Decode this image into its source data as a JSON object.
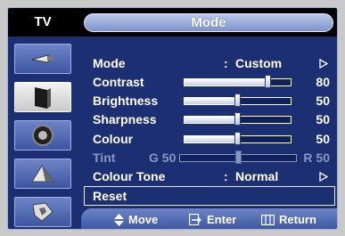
{
  "header": {
    "source_label": "TV",
    "title": "Mode"
  },
  "sidebar": {
    "items": [
      {
        "icon": "antenna-icon",
        "active": false
      },
      {
        "icon": "picture-icon",
        "active": true
      },
      {
        "icon": "sound-icon",
        "active": false
      },
      {
        "icon": "clock-icon",
        "active": false
      },
      {
        "icon": "setup-icon",
        "active": false
      }
    ]
  },
  "menu": {
    "mode": {
      "label": "Mode",
      "colon": ":",
      "value": "Custom"
    },
    "contrast": {
      "label": "Contrast",
      "value": "80",
      "level": 80
    },
    "brightness": {
      "label": "Brightness",
      "value": "50",
      "level": 50
    },
    "sharpness": {
      "label": "Sharpness",
      "value": "50",
      "level": 50
    },
    "colour": {
      "label": "Colour",
      "value": "50",
      "level": 50
    },
    "tint": {
      "label": "Tint",
      "left": "G 50",
      "right": "R 50",
      "level": 50
    },
    "colour_tone": {
      "label": "Colour Tone",
      "colon": ":",
      "value": "Normal"
    },
    "reset": {
      "label": "Reset"
    }
  },
  "footer": {
    "move": "Move",
    "enter": "Enter",
    "return": "Return"
  },
  "colors": {
    "panel": "#1c2f73",
    "header": "#000000",
    "highlight": "#ffffff"
  }
}
